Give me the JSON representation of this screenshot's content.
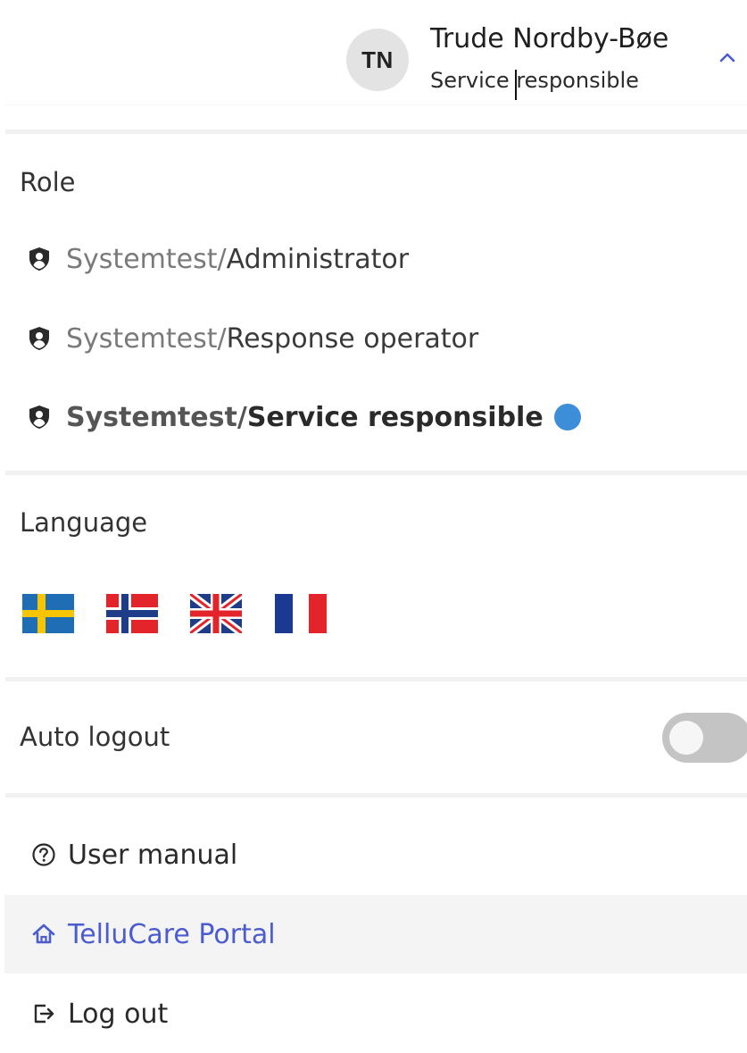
{
  "user": {
    "initials": "TN",
    "name": "Trude Nordby-Bøe",
    "role": "Service responsible"
  },
  "role_section": {
    "title": "Role",
    "items": [
      {
        "org": "Systemtest",
        "separator": " / ",
        "name": "Administrator",
        "active": false,
        "icon": "shield-user-icon"
      },
      {
        "org": "Systemtest",
        "separator": " / ",
        "name": "Response operator",
        "active": false,
        "icon": "shield-user-icon"
      },
      {
        "org": "Systemtest",
        "separator": " / ",
        "name": "Service responsible",
        "active": true,
        "icon": "shield-user-icon"
      }
    ]
  },
  "language_section": {
    "title": "Language",
    "flags": [
      "swedish-flag-icon",
      "norwegian-flag-icon",
      "uk-flag-icon",
      "french-flag-icon"
    ]
  },
  "auto_logout": {
    "label": "Auto logout",
    "enabled": false
  },
  "menu": {
    "user_manual": {
      "label": "User manual",
      "icon": "help-circle-icon"
    },
    "portal": {
      "label": "TelluCare Portal",
      "icon": "home-icon"
    },
    "logout": {
      "label": "Log out",
      "icon": "logout-icon"
    }
  },
  "colors": {
    "accent": "#4a5cd0",
    "active_dot": "#3d8ed8",
    "toggle_off": "#c4c4c4"
  }
}
